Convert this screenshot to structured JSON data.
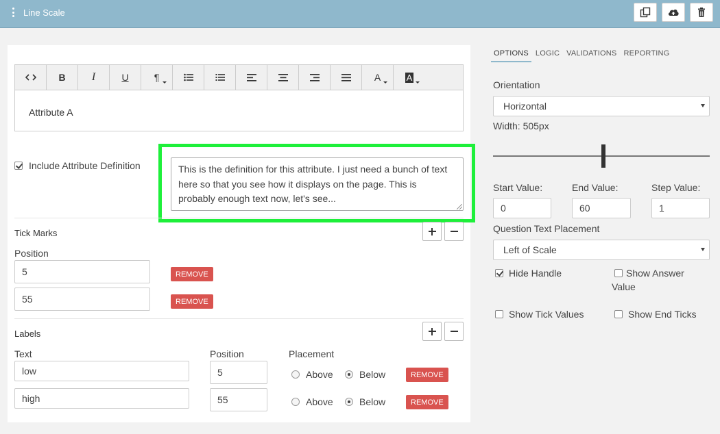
{
  "app": {
    "title": "Line Scale",
    "icons": {
      "menu": "vertical-dots-icon",
      "copy": "copy-icon",
      "upload": "cloud-upload-icon",
      "delete": "trash-icon"
    }
  },
  "editor": {
    "content": "Attribute A",
    "toolbar": [
      {
        "name": "code-view-icon",
        "glyph": "<>"
      },
      {
        "name": "bold-icon",
        "glyph": "B"
      },
      {
        "name": "italic-icon",
        "glyph": "I"
      },
      {
        "name": "underline-icon",
        "glyph": "U"
      },
      {
        "name": "paragraph-icon",
        "glyph": "¶"
      },
      {
        "name": "bullet-list-icon",
        "glyph": ""
      },
      {
        "name": "numbered-list-icon",
        "glyph": ""
      },
      {
        "name": "align-left-icon",
        "glyph": ""
      },
      {
        "name": "align-center-icon",
        "glyph": ""
      },
      {
        "name": "align-right-icon",
        "glyph": ""
      },
      {
        "name": "justify-icon",
        "glyph": ""
      },
      {
        "name": "font-color-icon",
        "glyph": "A"
      },
      {
        "name": "background-color-icon",
        "glyph": "A"
      }
    ]
  },
  "definition": {
    "include_label": "Include Attribute Definition",
    "include_checked": true,
    "text": "This is the definition for this attribute.  I just need a bunch of text here so that  you see how it displays on the page.  This is probably enough text now, let's see..."
  },
  "tick_marks": {
    "heading": "Tick Marks",
    "position_label": "Position",
    "remove_label": "REMOVE",
    "items": [
      {
        "position": "5"
      },
      {
        "position": "55"
      }
    ]
  },
  "labels": {
    "heading": "Labels",
    "text_label": "Text",
    "position_label": "Position",
    "placement_label": "Placement",
    "above_label": "Above",
    "below_label": "Below",
    "remove_label": "REMOVE",
    "items": [
      {
        "text": "low",
        "position": "5",
        "placement": "Below"
      },
      {
        "text": "high",
        "position": "55",
        "placement": "Below"
      }
    ]
  },
  "right": {
    "tabs": [
      "OPTIONS",
      "LOGIC",
      "VALIDATIONS",
      "REPORTING"
    ],
    "active_tab": "OPTIONS",
    "orientation_label": "Orientation",
    "orientation_value": "Horizontal",
    "width_label": "Width: 505px",
    "width_slider_fraction": 0.51,
    "start_label": "Start Value:",
    "start_value": "0",
    "end_label": "End Value:",
    "end_value": "60",
    "step_label": "Step Value:",
    "step_value": "1",
    "placement_label": "Question Text Placement",
    "placement_value": "Left of Scale",
    "options": {
      "hide_handle": {
        "label": "Hide Handle",
        "checked": true
      },
      "show_answer_value": {
        "label": "Show Answer Value",
        "checked": false
      },
      "show_tick_values": {
        "label": "Show Tick Values",
        "checked": false
      },
      "show_end_ticks": {
        "label": "Show End Ticks",
        "checked": false
      }
    }
  },
  "colors": {
    "topbar": "#8fb8cc",
    "highlight": "#1ef03a",
    "remove": "#d9534f"
  }
}
